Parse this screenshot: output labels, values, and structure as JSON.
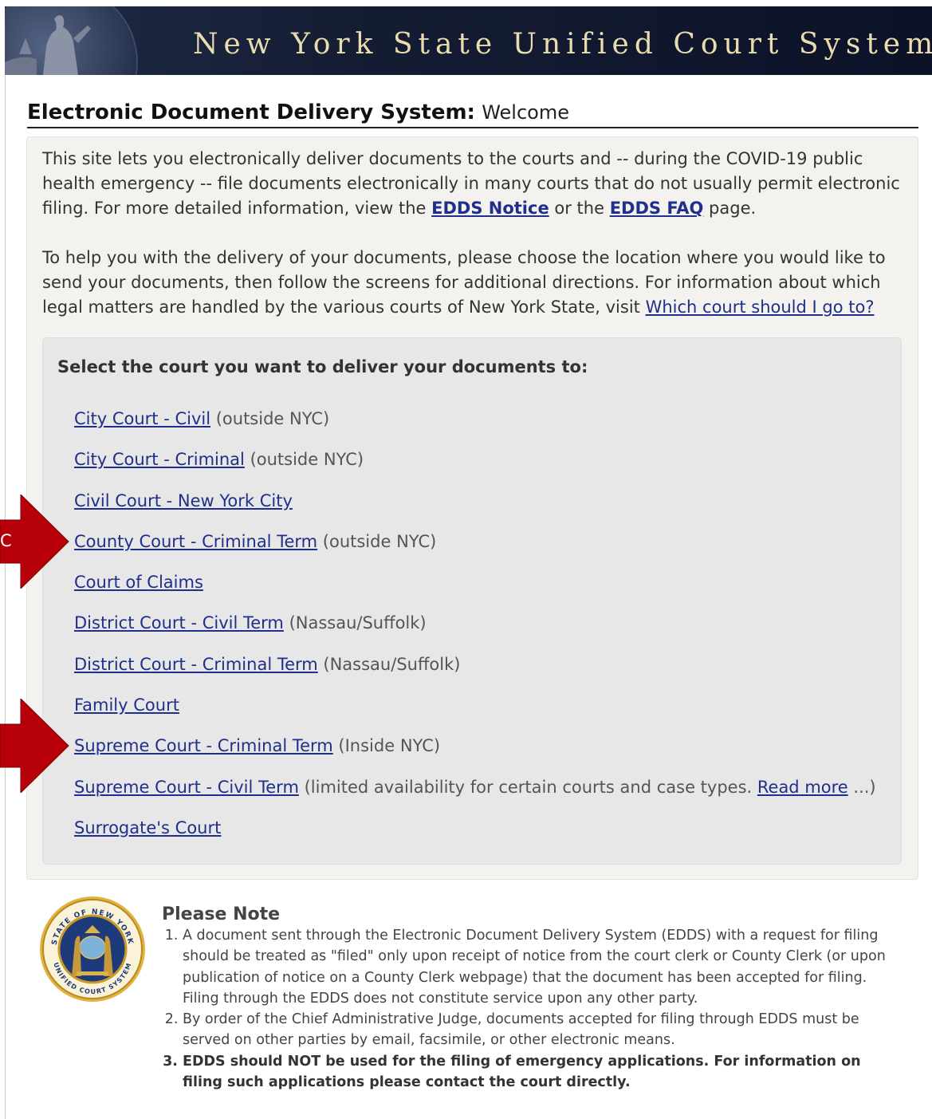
{
  "header": {
    "title": "New York State Unified Court System"
  },
  "page": {
    "heading": "Electronic Document Delivery System:",
    "subheading": "Welcome"
  },
  "intro": {
    "p1_text1": "This site lets you electronically deliver documents to the courts and -- during the COVID-19 public health emergency -- file documents electronically in many courts that do not usually permit electronic filing. For more detailed information, view the ",
    "p1_link1": "EDDS Notice",
    "p1_text2": " or the ",
    "p1_link2": "EDDS FAQ",
    "p1_text3": " page.",
    "p2_text1": "To help you with the delivery of your documents, please choose the location where you would like to send your documents, then follow the screens for additional directions. For information about which legal matters are handled by the various courts of New York State, visit ",
    "p2_link": "Which court should I go to?"
  },
  "court_select": {
    "heading": "Select the court you want to deliver your documents to:",
    "courts": [
      {
        "link": "City Court - Civil",
        "note": " (outside NYC)"
      },
      {
        "link": "City Court - Criminal",
        "note": " (outside NYC)"
      },
      {
        "link": "Civil Court - New York City",
        "note": ""
      },
      {
        "link": "County Court - Criminal Term",
        "note": " (outside NYC)"
      },
      {
        "link": "Court of Claims",
        "note": ""
      },
      {
        "link": "District Court - Civil Term",
        "note": " (Nassau/Suffolk)"
      },
      {
        "link": "District Court - Criminal Term",
        "note": " (Nassau/Suffolk)"
      },
      {
        "link": "Family Court",
        "note": ""
      },
      {
        "link": "Supreme Court - Criminal Term",
        "note": " (Inside NYC)"
      },
      {
        "link": "Supreme Court - Civil Term",
        "note": " (limited availability for certain courts and case types. ",
        "extra_link": "Read more",
        "extra_note": " ...)"
      },
      {
        "link": "Surrogate's Court",
        "note": ""
      }
    ]
  },
  "annotation": {
    "arrow_color": "#b80009",
    "letter": "C"
  },
  "note": {
    "title": "Please Note",
    "seal_text": [
      "STATE OF NEW YORK",
      "UNIFIED COURT SYSTEM"
    ],
    "items": [
      "A document sent through the Electronic Document Delivery System (EDDS) with a request for filing should be treated as \"filed\" only upon receipt of notice from the court clerk or County Clerk (or upon publication of notice on a County Clerk webpage) that the document has been accepted for filing. Filing through the EDDS does not constitute service upon any other party.",
      "By order of the Chief Administrative Judge, documents accepted for filing through EDDS must be served on other parties by email, facsimile, or other electronic means.",
      "EDDS should NOT be used for the filing of emergency applications. For information on filing such applications please contact the court directly."
    ]
  }
}
